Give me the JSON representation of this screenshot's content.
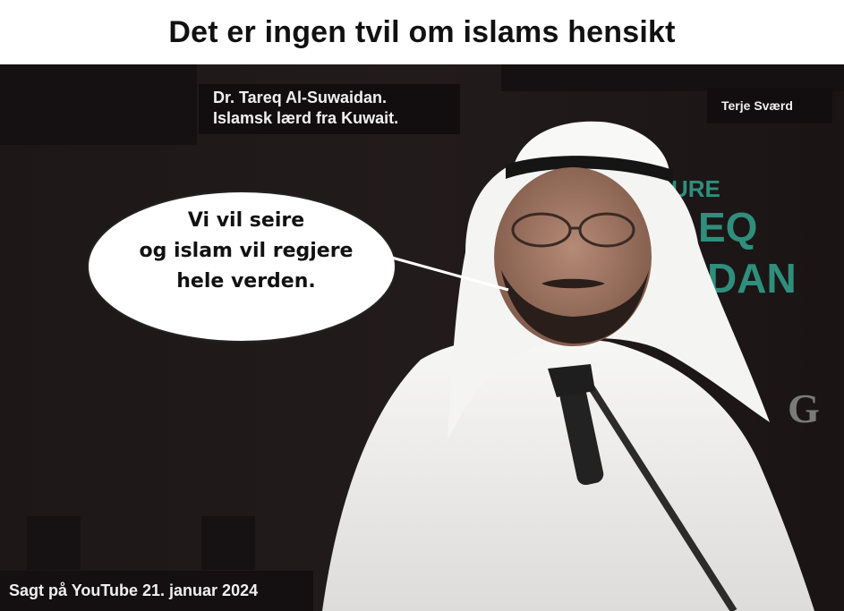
{
  "headline": "Det er ingen tvil om islams hensikt",
  "speaker": {
    "line1": "Dr. Tareq Al-Suwaidan.",
    "line2": "Islamsk lærd fra Kuwait."
  },
  "author": "Terje Sværd",
  "speech_bubble": {
    "lines": [
      "Vi vil seire",
      "og islam vil regjere",
      "hele verden."
    ]
  },
  "source": "Sagt på YouTube 21. januar 2024",
  "backdrop_text": [
    "URE",
    "EQ",
    "DAN",
    "G"
  ],
  "colors": {
    "background": "#1b1617",
    "label_box": "#120e0f",
    "backdrop_text": "#2f8e7c",
    "robe": "#f2f2f0"
  }
}
